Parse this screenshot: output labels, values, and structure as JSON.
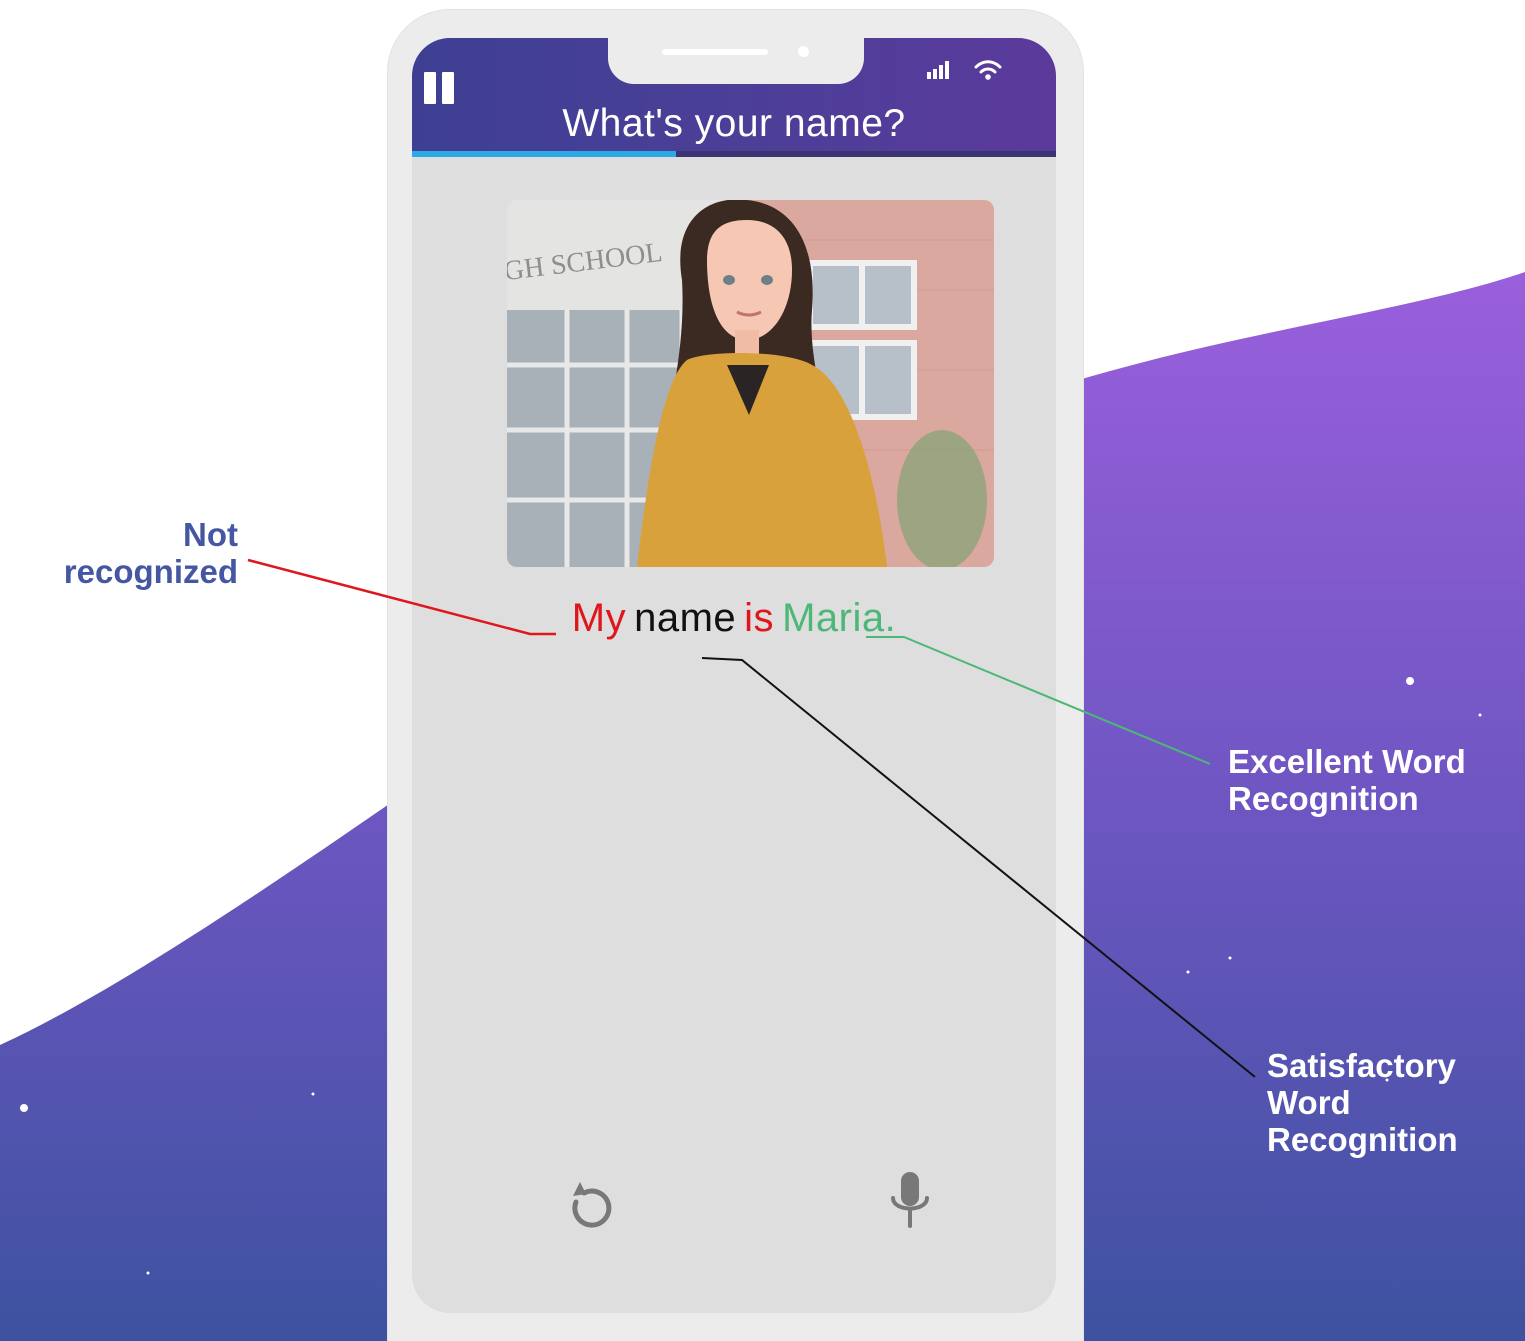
{
  "app": {
    "prompt_title": "What's your name?",
    "progress_fraction": 0.41
  },
  "scene": {
    "sign_text": "GH SCHOOL"
  },
  "sentence": {
    "words": [
      {
        "text": "My",
        "status": "not-recognized",
        "color": "#e0161d"
      },
      {
        "text": "name",
        "status": "satisfactory",
        "color": "#111111"
      },
      {
        "text": "is",
        "status": "not-recognized",
        "color": "#e0161d"
      },
      {
        "text": "Maria.",
        "status": "excellent",
        "color": "#4cb877"
      }
    ]
  },
  "controls": {
    "replay_icon": "replay-icon",
    "mic_icon": "microphone-icon",
    "pause_icon": "pause-icon"
  },
  "legend": {
    "not_recognized": "Not recognized",
    "excellent": "Excellent Word Recognition",
    "satisfactory": "Satisfactory Word Recognition"
  },
  "colors": {
    "header": "#4b3f98",
    "progress": "#2ea9e8",
    "wave_top": "#9a5fdc",
    "wave_bottom": "#3d52a0",
    "not_recognized_line": "#e0161d",
    "excellent_line": "#4cb877",
    "satisfactory_line": "#111111"
  }
}
